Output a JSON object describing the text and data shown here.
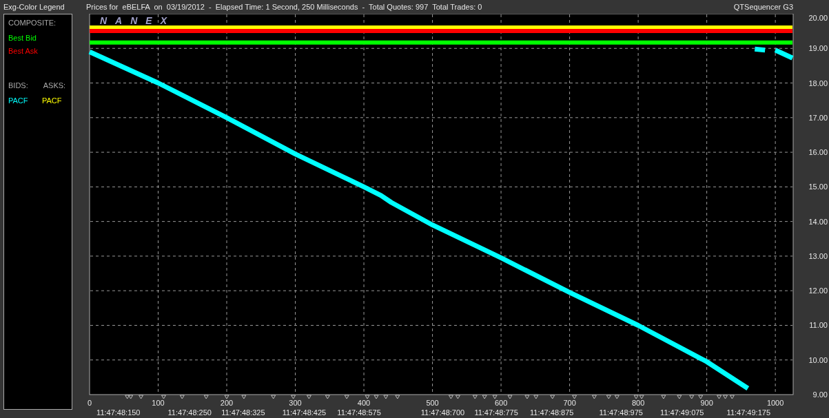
{
  "legend": {
    "title": "Exg-Color Legend",
    "composite_heading": "COMPOSITE:",
    "composite": [
      {
        "label": "Best Bid",
        "color": "#00ff00"
      },
      {
        "label": "Best Ask",
        "color": "#ff0000"
      }
    ],
    "bids_heading": "BIDS:",
    "asks_heading": "ASKS:",
    "bids": [
      {
        "label": "PACF",
        "color": "#00ffff"
      }
    ],
    "asks": [
      {
        "label": "PACF",
        "color": "#ffff00"
      }
    ]
  },
  "header": {
    "title": "Prices for  eBELFA  on  03/19/2012  -  Elapsed Time: 1 Second, 250 Milliseconds  -  Total Quotes: 997  Total Trades: 0",
    "product": "QTSequencer G3"
  },
  "chart": {
    "logo": "NANEX",
    "chart_data": {
      "type": "line",
      "x": [
        0,
        100,
        200,
        300,
        400,
        425,
        440,
        500,
        600,
        700,
        800,
        900,
        960,
        965,
        970,
        985,
        995,
        1000,
        1025
      ],
      "series": [
        {
          "color": "#ffff00",
          "values": [
            19.6,
            19.6,
            19.6,
            19.6,
            19.6,
            19.6,
            19.6,
            19.6,
            19.6,
            19.6,
            19.6,
            19.6,
            19.6,
            19.6,
            19.6,
            19.6,
            19.6,
            19.6,
            19.6
          ]
        },
        {
          "color": "#ff0000",
          "values": [
            19.5,
            19.5,
            19.5,
            19.5,
            19.5,
            19.5,
            19.5,
            19.5,
            19.5,
            19.5,
            19.5,
            19.5,
            19.5,
            19.5,
            19.5,
            19.5,
            19.5,
            19.5,
            19.5
          ]
        },
        {
          "color": "#00ff00",
          "values": [
            19.17,
            19.17,
            19.17,
            19.17,
            19.17,
            19.17,
            19.17,
            19.17,
            19.17,
            19.17,
            19.17,
            19.17,
            19.17,
            19.17,
            19.17,
            19.17,
            19.17,
            19.17,
            19.17
          ]
        },
        {
          "color": "#00ffff",
          "values": [
            18.9,
            18.0,
            17.0,
            15.95,
            15.0,
            14.75,
            14.55,
            13.9,
            12.95,
            11.95,
            11.0,
            9.95,
            9.18,
            null,
            18.98,
            18.95,
            null,
            18.95,
            18.72
          ]
        }
      ],
      "xlim": [
        0,
        1026
      ],
      "ylim": [
        9,
        20
      ],
      "grid": true,
      "xticks": [
        0,
        100,
        200,
        300,
        400,
        500,
        600,
        700,
        800,
        900,
        1000
      ],
      "yticks": [
        {
          "value": 9,
          "label": "9.00"
        },
        {
          "value": 10,
          "label": "10.00"
        },
        {
          "value": 11,
          "label": "11.00"
        },
        {
          "value": 12,
          "label": "12.00"
        },
        {
          "value": 13,
          "label": "13.00"
        },
        {
          "value": 14,
          "label": "14.00"
        },
        {
          "value": 15,
          "label": "15.00"
        },
        {
          "value": 16,
          "label": "16.00"
        },
        {
          "value": 17,
          "label": "17.00"
        },
        {
          "value": 18,
          "label": "18.00"
        },
        {
          "value": 19,
          "label": "19.00"
        },
        {
          "value": 20,
          "label": "20.00"
        }
      ]
    },
    "time_labels": [
      "11:47:48:150",
      "11:47:48:250",
      "11:47:48:325",
      "11:47:48:425",
      "11:47:48:575",
      "11:47:48:700",
      "11:47:48:775",
      "11:47:48:875",
      "11:47:48:975",
      "11:47:49:075",
      "11:47:49:175"
    ]
  }
}
